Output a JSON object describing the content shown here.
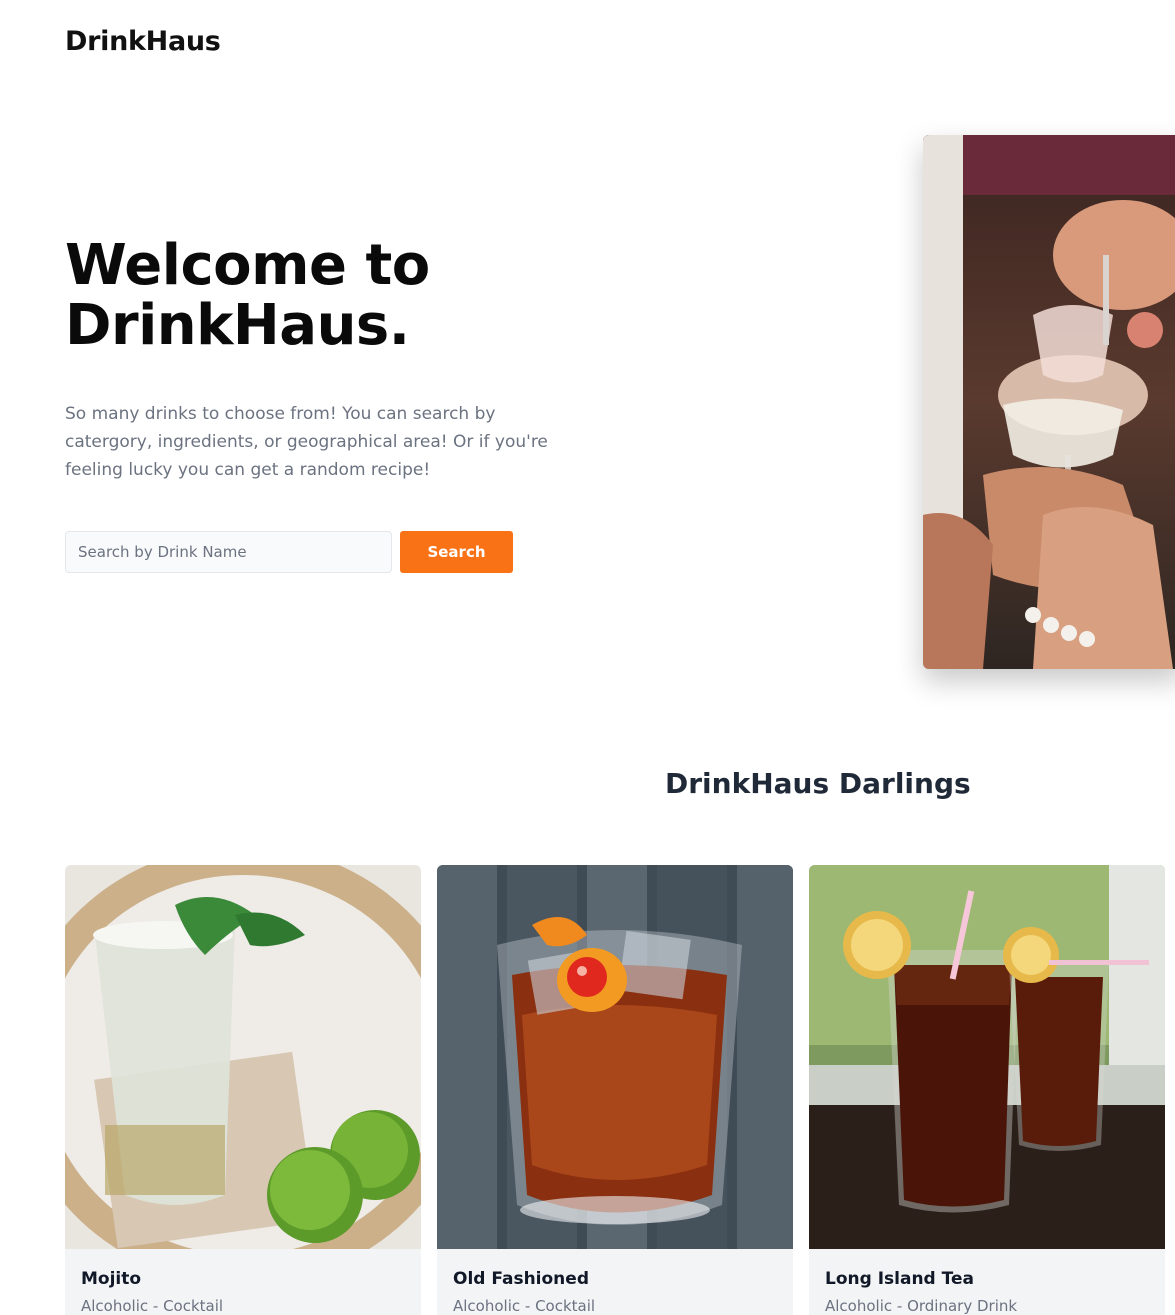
{
  "header": {
    "brand": "DrinkHaus"
  },
  "hero": {
    "title_line1": "Welcome to",
    "title_line2": "DrinkHaus.",
    "description": "So many drinks to choose from! You can search by catergory, ingredients, or geographical area! Or if you're feeling lucky you can get a random recipe!",
    "search_placeholder": "Search by Drink Name",
    "search_button": "Search"
  },
  "section": {
    "title": "DrinkHaus Darlings",
    "cards": [
      {
        "name": "Mojito",
        "subtitle": "Alcoholic - Cocktail"
      },
      {
        "name": "Old Fashioned",
        "subtitle": "Alcoholic - Cocktail"
      },
      {
        "name": "Long Island Tea",
        "subtitle": "Alcoholic - Ordinary Drink"
      }
    ]
  },
  "colors": {
    "accent": "#f97316",
    "card_bg": "#f3f4f6",
    "muted_text": "#6b7280"
  }
}
